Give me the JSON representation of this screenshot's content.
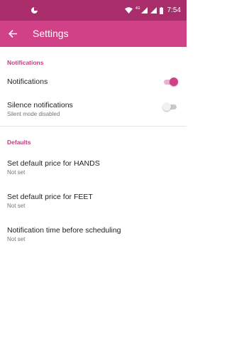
{
  "colors": {
    "status_bar": "#a92d6b",
    "app_bar": "#d14187",
    "accent": "#d14187",
    "section_header": "#c73a7f"
  },
  "status_bar": {
    "network_label": "4G",
    "time": "7:54",
    "icons": [
      "app-notification-icon",
      "wifi-icon",
      "cell-signal-icon",
      "cell-signal-icon",
      "battery-icon"
    ]
  },
  "app_bar": {
    "back_icon": "arrow-left-icon",
    "title": "Settings"
  },
  "sections": {
    "notifications": {
      "header": "Notifications",
      "notifications_row": {
        "title": "Notifications",
        "switch_on": true
      },
      "silence_row": {
        "title": "Silence notifications",
        "summary": "Silent mode disabled",
        "switch_on": false
      }
    },
    "defaults": {
      "header": "Defaults",
      "hands_row": {
        "title": "Set default price for HANDS",
        "summary": "Not set"
      },
      "feet_row": {
        "title": "Set default price for FEET",
        "summary": "Not set"
      },
      "notif_time_row": {
        "title": "Notification time before scheduling",
        "summary": "Not set"
      }
    }
  }
}
